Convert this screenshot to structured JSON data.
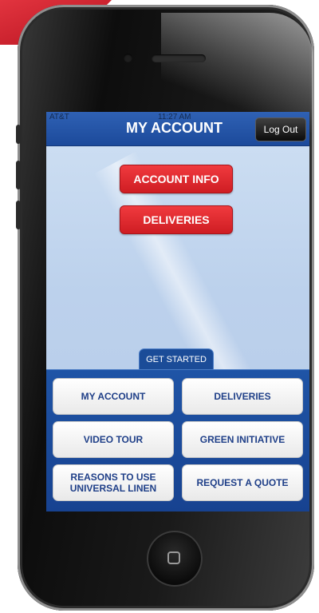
{
  "status_bar": {
    "carrier": "AT&T",
    "time": "11:27 AM"
  },
  "navbar": {
    "title": "MY ACCOUNT",
    "logout_label": "Log Out"
  },
  "actions": {
    "account_info_label": "ACCOUNT INFO",
    "deliveries_label": "DELIVERIES"
  },
  "menu": {
    "tab_label": "GET STARTED",
    "items": [
      {
        "label": "MY ACCOUNT"
      },
      {
        "label": "DELIVERIES"
      },
      {
        "label": "VIDEO TOUR"
      },
      {
        "label": "GREEN INITIATIVE"
      },
      {
        "label": "REASONS TO USE UNIVERSAL LINEN"
      },
      {
        "label": "REQUEST A QUOTE"
      }
    ]
  },
  "colors": {
    "accent_red": "#d8242a",
    "brand_blue": "#1c4a9b"
  },
  "icons": {
    "home": "home-button-icon"
  }
}
